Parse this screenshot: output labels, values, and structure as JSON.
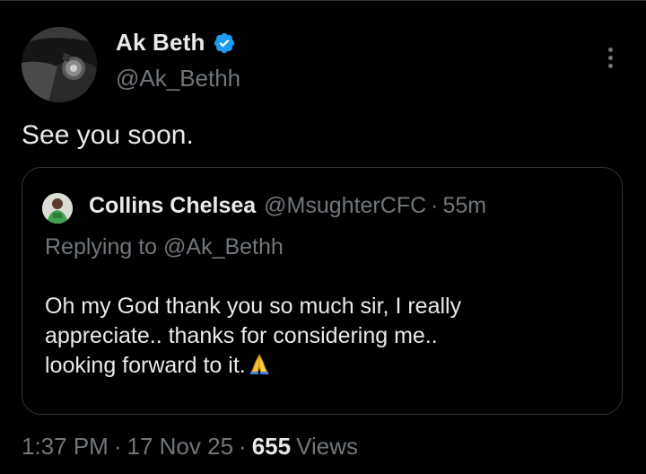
{
  "author": {
    "name": "Ak Beth",
    "handle": "@Ak_Bethh",
    "verified": true
  },
  "tweet": {
    "text": "See you soon."
  },
  "quoted_tweet": {
    "author_name": "Collins Chelsea",
    "author_handle": "@MsughterCFC",
    "separator": "·",
    "time_ago": "55m",
    "replying_to": "Replying to @Ak_Bethh",
    "body_lines": [
      "Oh my God thank you so much sir, I really",
      "appreciate.. thanks for considering me..",
      "looking forward to it."
    ],
    "body_emoji": "pray-hands-icon"
  },
  "meta": {
    "time": "1:37 PM",
    "separator": "·",
    "date": "17 Nov 25",
    "views_count": "655",
    "views_label": "Views"
  },
  "icons": {
    "verified": "verified-badge-icon",
    "more": "more-options-icon"
  },
  "colors": {
    "background": "#000000",
    "primary_text": "#e7e9ea",
    "secondary_text": "#71767b",
    "border": "#2f3336",
    "verified_blue": "#1d9bf0",
    "emoji_yellow": "#f7c22f"
  }
}
